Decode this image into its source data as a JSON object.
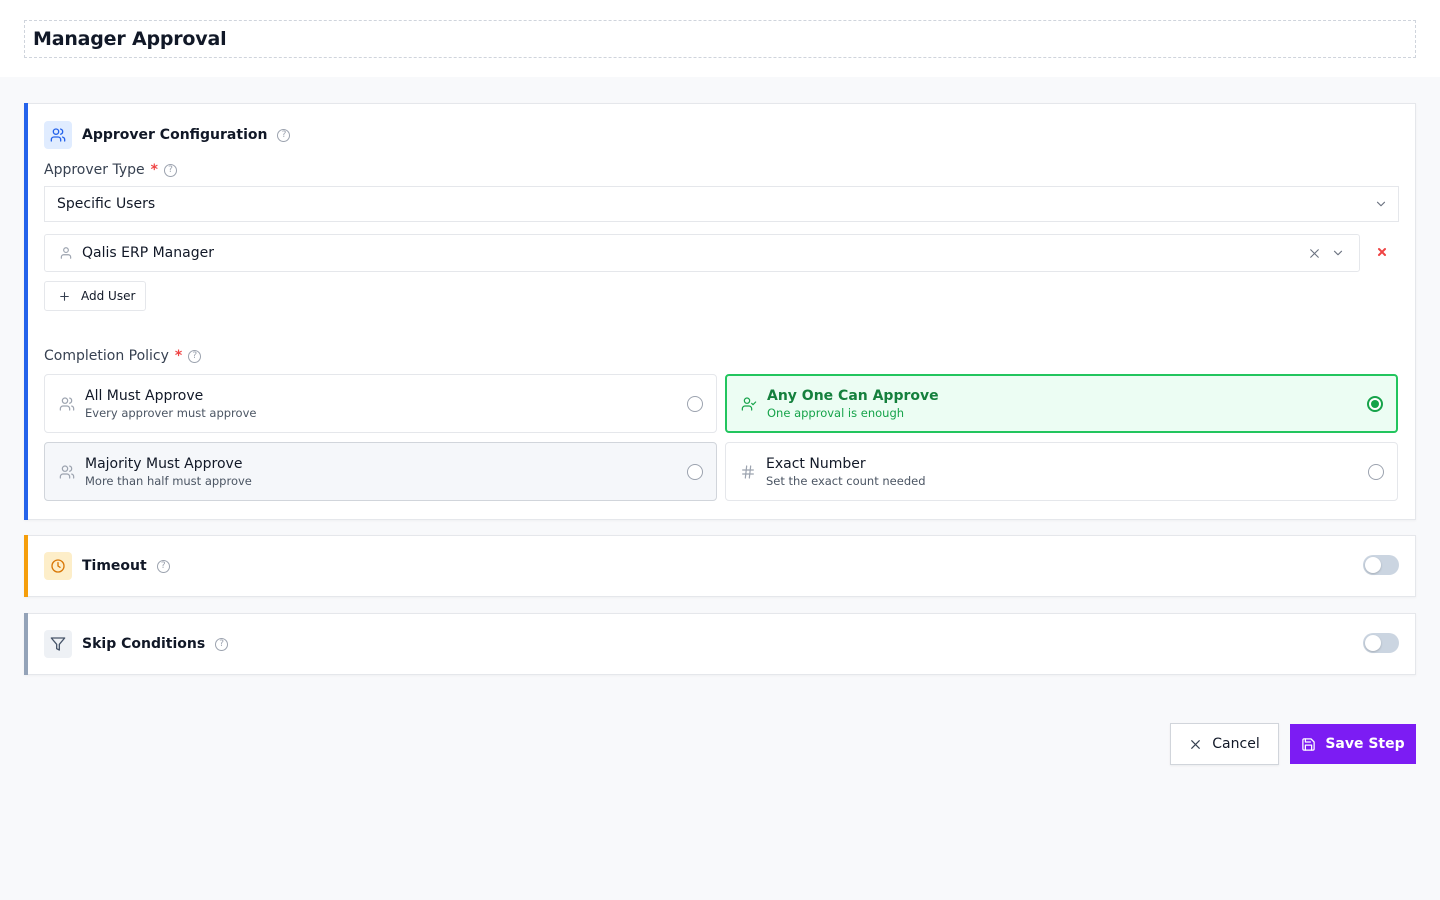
{
  "page": {
    "title": "Manager Approval"
  },
  "approver_config": {
    "title": "Approver Configuration",
    "approver_type": {
      "label": "Approver Type",
      "required_mark": "*",
      "value": "Specific Users"
    },
    "users": [
      {
        "name": "Qalis ERP Manager"
      }
    ],
    "add_user_label": "Add User",
    "remove_icon": "close-icon",
    "completion_policy": {
      "label": "Completion Policy",
      "required_mark": "*",
      "selected": "any_one",
      "options": [
        {
          "id": "all",
          "title": "All Must Approve",
          "description": "Every approver must approve",
          "icon": "users-icon"
        },
        {
          "id": "any_one",
          "title": "Any One Can Approve",
          "description": "One approval is enough",
          "icon": "user-check-icon"
        },
        {
          "id": "majority",
          "title": "Majority Must Approve",
          "description": "More than half must approve",
          "icon": "users-icon"
        },
        {
          "id": "exact",
          "title": "Exact Number",
          "description": "Set the exact count needed",
          "icon": "hash-icon"
        }
      ]
    }
  },
  "timeout": {
    "title": "Timeout",
    "enabled": false,
    "icon": "clock-icon"
  },
  "skip_conditions": {
    "title": "Skip Conditions",
    "enabled": false,
    "icon": "filter-icon"
  },
  "actions": {
    "cancel_label": "Cancel",
    "save_label": "Save Step"
  },
  "colors": {
    "accent_blue": "#2563eb",
    "timeout_accent": "#f59e0b",
    "skip_accent": "#94a3b8",
    "selected_green": "#16a34a",
    "save_purple": "#7c1cf3",
    "required_red": "#ef4444"
  }
}
